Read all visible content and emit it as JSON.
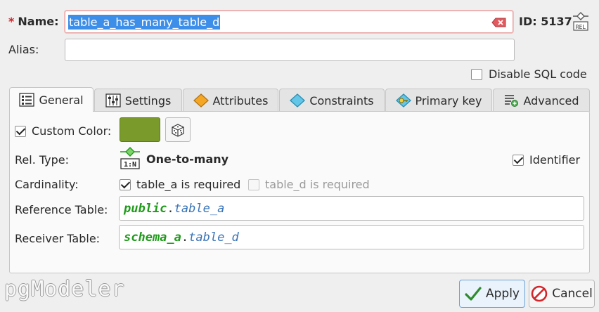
{
  "form": {
    "name_label": "Name:",
    "name_value": "table_a_has_many_table_d",
    "id_label": "ID: 5137",
    "alias_label": "Alias:",
    "alias_value": "",
    "disable_sql_label": "Disable SQL code",
    "disable_sql_checked": false
  },
  "tabs": [
    {
      "label": "General",
      "active": true
    },
    {
      "label": "Settings",
      "active": false
    },
    {
      "label": "Attributes",
      "active": false
    },
    {
      "label": "Constraints",
      "active": false
    },
    {
      "label": "Primary key",
      "active": false
    },
    {
      "label": "Advanced",
      "active": false
    }
  ],
  "general": {
    "custom_color_label": "Custom Color:",
    "custom_color_checked": true,
    "custom_color_value": "#7b9a2c",
    "rel_type_label": "Rel. Type:",
    "rel_type_badge": "1:N",
    "rel_type_value": "One-to-many",
    "identifier_label": "Identifier",
    "identifier_checked": true,
    "cardinality_label": "Cardinality:",
    "card_a_label": "table_a is required",
    "card_a_checked": true,
    "card_d_label": "table_d is required",
    "card_d_checked": false,
    "reference_table_label": "Reference Table:",
    "reference_schema": "public",
    "reference_table": "table_a",
    "receiver_table_label": "Receiver Table:",
    "receiver_schema": "schema_a",
    "receiver_table": "table_d",
    "dot": "."
  },
  "footer": {
    "logo": "pgModeler",
    "apply_label": "Apply",
    "cancel_label": "Cancel"
  },
  "colors": {
    "accent": "#3d8ee8",
    "schema": "#1f9b1a",
    "table": "#3974b7"
  }
}
